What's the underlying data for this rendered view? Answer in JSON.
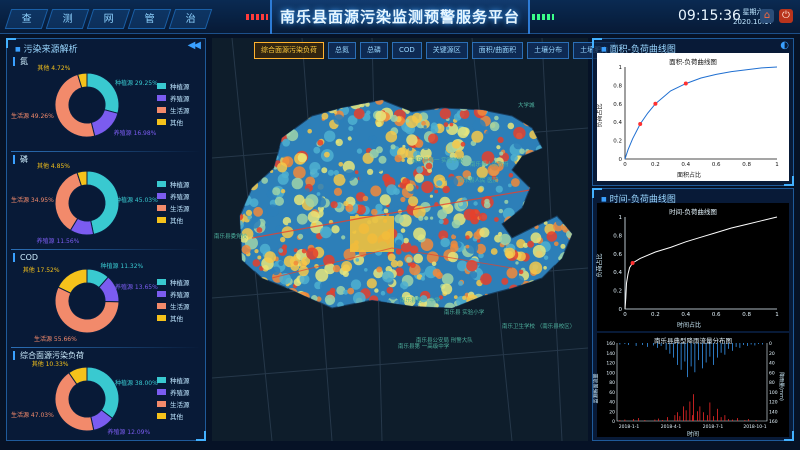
{
  "header": {
    "nav": [
      "查",
      "测",
      "网",
      "管",
      "治"
    ],
    "title": "南乐县面源污染监测预警服务平台",
    "time": "09:15:36",
    "weekday": "星期六",
    "date": "2020.10.17",
    "home_icon": "home-icon",
    "exit_icon": "power-icon",
    "accent": "#3aa0ff"
  },
  "left_panel": {
    "title": "污染来源解析",
    "colors": {
      "种植源": "#39c9d0",
      "养殖源": "#7b5cf0",
      "生活源": "#f28a6b",
      "其他": "#f5c21b"
    },
    "legend": [
      "种植源",
      "养殖源",
      "生活源",
      "其他"
    ],
    "sections": [
      {
        "title": "氮",
        "labels": {
          "其他": "其他 4.72%",
          "种植源": "种植源 29.25%",
          "养殖源": "养殖源 16.98%",
          "生活源": "生活源 49.26%"
        }
      },
      {
        "title": "磷",
        "labels": {
          "其他": "其他 4.85%",
          "种植源": "种植源 45.03%",
          "养殖源": "养殖源 11.56%",
          "生活源": "生活源 34.95%"
        }
      },
      {
        "title": "COD",
        "labels": {
          "其他": "其他 17.52%",
          "种植源": "种植源 11.32%",
          "养殖源": "养殖源 13.65%",
          "生活源": "生活源 55.66%"
        }
      },
      {
        "title": "综合面源污染负荷",
        "labels": {
          "其他": "其他 10.33%",
          "种植源": "种植源 38.00%",
          "养殖源": "养殖源 12.09%",
          "生活源": "生活源 47.03%"
        }
      }
    ]
  },
  "map": {
    "tabs": [
      "综合面源污染负荷",
      "总氮",
      "总磷",
      "COD",
      "关键源区",
      "面积/曲面积",
      "土壤分布",
      "土壤肥力"
    ],
    "active_tab": 0,
    "labels": [
      "大学城",
      "南乐县人民政府",
      "南乐县人民\n医院",
      "南乐县委党校",
      "南乐县第一\n实验学校",
      "南乐县第一\n中学",
      "南乐县\n实验小学",
      "南乐县公安局\n刑警大队",
      "南乐卫生学校\n（南乐县校区）",
      "南乐县第\n一高级中学"
    ]
  },
  "right_panel": {
    "area_section": "面积-负荷曲线图",
    "area_chart_title": "面积-负荷曲线图",
    "area_xlabel": "面积占比",
    "area_ylabel": "负荷占比",
    "time_section": "时间-负荷曲线图",
    "time_chart_title": "时间-负荷曲线图",
    "time_xlabel": "时间占比",
    "time_ylabel": "负荷占比",
    "rain_chart_title": "南乐县典型降雨流量分布图",
    "rain_xlabel": "时间",
    "rain_ylabel_left": "监测断面流量",
    "rain_ylabel_right": "降雨量(mm)"
  },
  "chart_data": [
    {
      "type": "line",
      "title": "面积-负荷曲线图",
      "xlabel": "面积占比",
      "ylabel": "负荷占比",
      "xlim": [
        0,
        1
      ],
      "ylim": [
        0,
        1
      ],
      "x_ticks": [
        "0",
        "0.2",
        "0.4",
        "0.6",
        "0.8",
        "1"
      ],
      "y_ticks": [
        "0",
        "0.2",
        "0.4",
        "0.6",
        "0.8",
        "1"
      ],
      "x": [
        0,
        0.02,
        0.05,
        0.1,
        0.15,
        0.2,
        0.25,
        0.3,
        0.4,
        0.5,
        0.6,
        0.7,
        0.8,
        0.9,
        1.0
      ],
      "y": [
        0,
        0.1,
        0.22,
        0.38,
        0.5,
        0.6,
        0.67,
        0.74,
        0.82,
        0.88,
        0.92,
        0.95,
        0.97,
        0.99,
        1.0
      ],
      "markers": [
        {
          "x": 0.1,
          "y": 0.38
        },
        {
          "x": 0.2,
          "y": 0.6
        },
        {
          "x": 0.4,
          "y": 0.82
        }
      ],
      "line_color": "#ffffff",
      "marker_color": "#ff3030"
    },
    {
      "type": "line",
      "title": "时间-负荷曲线图",
      "xlabel": "时间占比",
      "ylabel": "负荷占比",
      "xlim": [
        0,
        1
      ],
      "ylim": [
        0,
        1
      ],
      "x_ticks": [
        "0",
        "0.2",
        "0.4",
        "0.6",
        "0.8",
        "1"
      ],
      "y_ticks": [
        "0",
        "0.2",
        "0.4",
        "0.6",
        "0.8",
        "1"
      ],
      "x": [
        0,
        0.005,
        0.01,
        0.02,
        0.03,
        0.05,
        0.1,
        0.2,
        0.3,
        0.4,
        0.5,
        0.6,
        0.7,
        0.8,
        0.9,
        1.0
      ],
      "y": [
        0,
        0.12,
        0.28,
        0.38,
        0.45,
        0.5,
        0.55,
        0.62,
        0.67,
        0.73,
        0.78,
        0.83,
        0.88,
        0.92,
        0.96,
        1.0
      ],
      "markers": [
        {
          "x": 0.05,
          "y": 0.5
        }
      ],
      "line_color": "#ffffff",
      "marker_color": "#ff3030"
    },
    {
      "type": "bar",
      "title": "南乐县典型降雨流量分布图",
      "xlabel": "时间",
      "ylabel_left": "监测断面流量",
      "ylabel_right": "降雨量(mm)",
      "x_ticks": [
        "2018-1-1",
        "2018-4-1",
        "2018-7-1",
        "2018-10-1"
      ],
      "y_left_ticks": [
        "0",
        "20",
        "40",
        "60",
        "80",
        "100",
        "120",
        "140",
        "160"
      ],
      "y_right_ticks": [
        "0",
        "20",
        "40",
        "60",
        "80",
        "100",
        "120",
        "140",
        "160"
      ],
      "series": [
        {
          "name": "流量",
          "color": "#ff2a2a",
          "values": [
            0,
            0,
            2,
            0,
            0,
            0,
            3,
            0,
            0,
            0,
            0,
            0,
            0,
            4,
            0,
            0,
            0,
            6,
            0,
            0,
            0,
            0,
            2,
            0,
            0,
            0,
            0,
            0,
            0,
            0,
            3,
            0,
            0,
            5,
            0,
            0,
            2,
            0,
            0,
            0,
            8,
            0,
            0,
            0,
            0,
            0,
            12,
            0,
            18,
            0,
            10,
            0,
            0,
            30,
            0,
            22,
            0,
            0,
            40,
            0,
            12,
            55,
            0,
            0,
            20,
            0,
            30,
            0,
            0,
            18,
            0,
            0,
            12,
            0,
            38,
            0,
            0,
            10,
            0,
            0,
            25,
            0,
            0,
            8,
            0,
            0,
            12,
            0,
            0,
            4,
            0,
            0,
            3,
            0,
            0,
            0,
            6,
            0,
            0,
            0,
            0,
            0,
            2,
            0,
            0,
            4,
            0,
            0,
            0,
            0,
            0,
            2,
            0,
            0,
            0,
            0,
            0,
            0,
            0,
            0
          ]
        },
        {
          "name": "降雨",
          "color": "#3aa0ff",
          "values": [
            0,
            0,
            3,
            0,
            0,
            0,
            2,
            0,
            0,
            4,
            0,
            0,
            0,
            0,
            0,
            6,
            0,
            0,
            0,
            0,
            4,
            0,
            0,
            0,
            8,
            0,
            0,
            0,
            0,
            5,
            0,
            0,
            10,
            0,
            0,
            6,
            0,
            0,
            0,
            14,
            0,
            0,
            22,
            0,
            0,
            30,
            0,
            0,
            45,
            0,
            0,
            55,
            0,
            0,
            38,
            0,
            70,
            0,
            0,
            48,
            0,
            0,
            60,
            0,
            0,
            35,
            0,
            0,
            52,
            0,
            0,
            40,
            0,
            0,
            28,
            0,
            0,
            45,
            0,
            0,
            30,
            0,
            0,
            20,
            0,
            0,
            24,
            0,
            0,
            12,
            0,
            0,
            16,
            0,
            0,
            8,
            0,
            0,
            10,
            0,
            0,
            4,
            0,
            0,
            6,
            0,
            0,
            3,
            0,
            0,
            5,
            0,
            0,
            2,
            0,
            0,
            3,
            0,
            0,
            0
          ]
        }
      ]
    }
  ]
}
